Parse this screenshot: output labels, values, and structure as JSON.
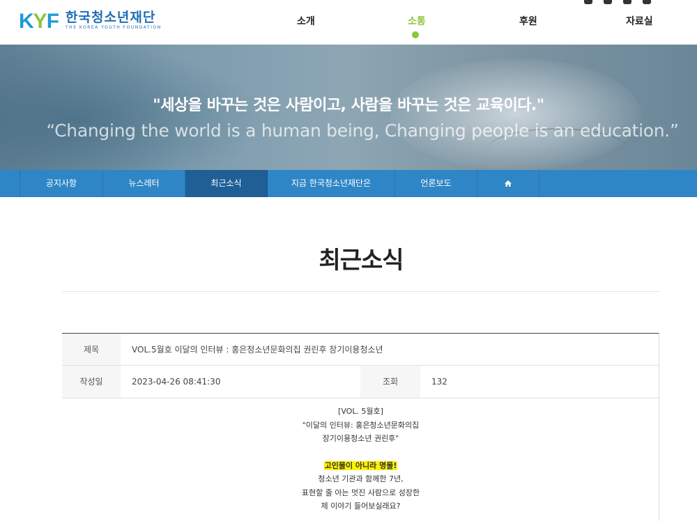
{
  "header": {
    "logo_mark": [
      "K",
      "Y",
      "F"
    ],
    "logo_kr": "한국청소년재단",
    "logo_en": "THE KOREA YOUTH FOUNDATION",
    "nav": [
      {
        "label": "소개"
      },
      {
        "label": "소통"
      },
      {
        "label": "후원"
      },
      {
        "label": "자료실"
      }
    ],
    "active_nav": "소통",
    "sns_icons": [
      "youtube-icon",
      "instagram-icon",
      "facebook-icon",
      "blog-icon"
    ]
  },
  "banner": {
    "quote_kr": "\"세상을 바꾸는 것은 사람이고, 사람을 바꾸는 것은 교육이다.\"",
    "quote_en": "“Changing the world is a human being, Changing people is an education.”"
  },
  "subnav": {
    "items": [
      {
        "label": "공지사항"
      },
      {
        "label": "뉴스레터"
      },
      {
        "label": "최근소식"
      },
      {
        "label": "지금 한국청소년재단은"
      },
      {
        "label": "언론보도"
      }
    ],
    "home_icon": "home-icon",
    "active": "최근소식"
  },
  "page": {
    "title": "최근소식"
  },
  "post": {
    "subject_label": "제목",
    "subject": "VOL.5월호 이달의 인터뷰 : 홍은청소년문화의집 권린후 장기이용청소년",
    "date_label": "작성일",
    "date": "2023-04-26 08:41:30",
    "views_label": "조회",
    "views": "132",
    "body": {
      "line1": "[VOL. 5월호]",
      "line2": "\"이달의 인터뷰: 홍은청소년문화의집",
      "line3": "장기이용청소년 권린후\"",
      "highlight": "고인물이 아니라 명물!",
      "line4": "청소년 기관과 함께한 7년,",
      "line5": "표현할 줄 아는 멋진 사람으로 성장한",
      "line6": "제 이야기 들어보실래요?"
    }
  },
  "colors": {
    "brand_blue": "#2f86c6",
    "active_tab": "#1f5f95",
    "accent_green": "#8cc63f",
    "highlight": "#fff200"
  }
}
